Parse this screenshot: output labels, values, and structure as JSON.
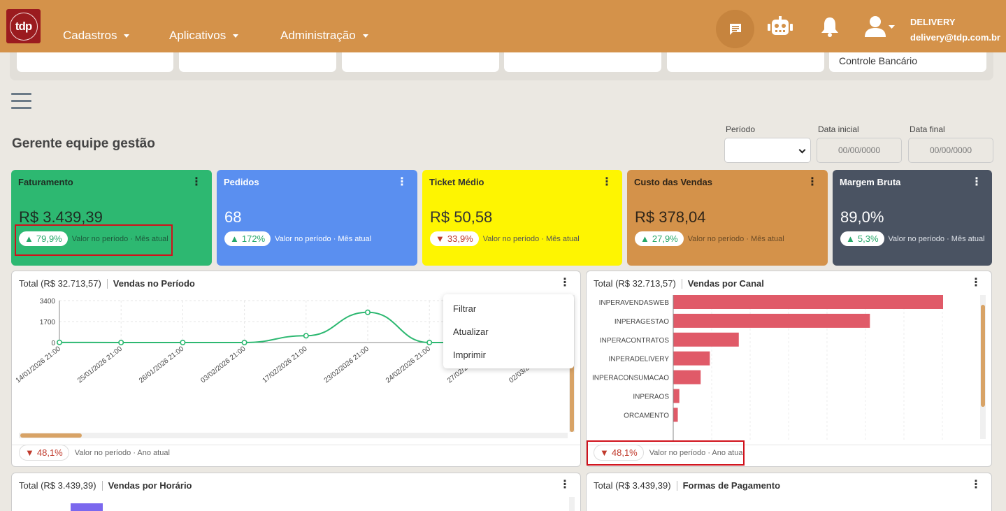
{
  "navbar": {
    "logo_text": "tdp",
    "menus": [
      {
        "label": "Cadastros"
      },
      {
        "label": "Aplicativos"
      },
      {
        "label": "Administração"
      }
    ],
    "user_name": "DELIVERY",
    "user_email": "delivery@tdp.com.br",
    "icons": [
      "chat-icon",
      "robot-icon",
      "bell-icon",
      "user-icon"
    ]
  },
  "shortcuts": {
    "last_label": "Controle Bancário"
  },
  "page": {
    "title": "Gerente equipe gestão"
  },
  "filters": {
    "period_label": "Período",
    "start_label": "Data inicial",
    "end_label": "Data final",
    "start_placeholder": "00/00/0000",
    "end_placeholder": "00/00/0000"
  },
  "kpis": [
    {
      "title": "Faturamento",
      "value": "R$ 3.439,39",
      "delta": "79,9%",
      "trend": "up",
      "note": "Valor no período · Mês atual",
      "color": "#2db871"
    },
    {
      "title": "Pedidos",
      "value": "68",
      "delta": "172%",
      "trend": "up",
      "note": "Valor no período · Mês atual",
      "color": "#5a8ff0"
    },
    {
      "title": "Ticket Médio",
      "value": "R$ 50,58",
      "delta": "33,9%",
      "trend": "down",
      "note": "Valor no período · Mês atual",
      "color": "#fef501"
    },
    {
      "title": "Custo das Vendas",
      "value": "R$ 378,04",
      "delta": "27,9%",
      "trend": "up",
      "note": "Valor no período · Mês atual",
      "color": "#d4924a"
    },
    {
      "title": "Margem Bruta",
      "value": "89,0%",
      "delta": "5,3%",
      "trend": "up",
      "note": "Valor no período · Mês atual",
      "color": "#4a5362"
    }
  ],
  "cards": {
    "vendas_periodo": {
      "total": "Total (R$ 32.713,57)",
      "title": "Vendas no Período",
      "footer_delta": "48,1%",
      "footer_note": "Valor no período · Ano atual"
    },
    "vendas_canal": {
      "total": "Total (R$ 32.713,57)",
      "title": "Vendas por Canal",
      "footer_delta": "48,1%",
      "footer_note": "Valor no período · Ano atual"
    },
    "vendas_horario": {
      "total": "Total (R$ 3.439,39)",
      "title": "Vendas por Horário"
    },
    "formas_pagamento": {
      "total": "Total (R$ 3.439,39)",
      "title": "Formas de Pagamento"
    }
  },
  "dropdown": {
    "items": [
      "Filtrar",
      "Atualizar",
      "Imprimir"
    ]
  },
  "chart_data": [
    {
      "type": "line",
      "yticks": [
        "3400",
        "1700",
        "0"
      ],
      "ylim": [
        0,
        3400
      ],
      "x": [
        "14/01/2026 21:00",
        "25/01/2026 21:00",
        "26/01/2026 21:00",
        "03/02/2026 21:00",
        "17/02/2026 21:00",
        "23/02/2026 21:00",
        "24/02/2026 21:00",
        "27/02/2026 21:00",
        "02/03/2026 21:00"
      ],
      "values": [
        10,
        0,
        0,
        0,
        550,
        2450,
        0,
        0,
        0
      ],
      "color": "#2db871"
    },
    {
      "type": "bar",
      "orientation": "horizontal",
      "categories": [
        "INPERAVENDASWEB",
        "INPERAGESTAO",
        "INPERACONTRATOS",
        "INPERADELIVERY",
        "INPERACONSUMACAO",
        "INPERAOS",
        "ORCAMENTO"
      ],
      "values": [
        17700,
        12900,
        4300,
        2400,
        1800,
        400,
        300
      ],
      "color": "#e05a68"
    }
  ]
}
